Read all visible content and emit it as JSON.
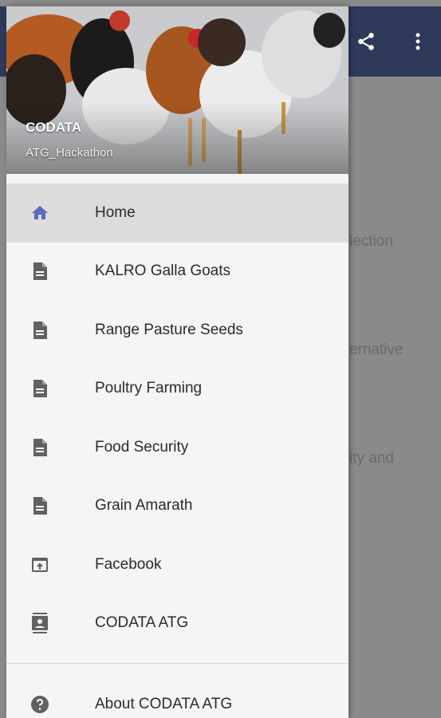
{
  "app": {
    "background_snippets": [
      "lection",
      "ernative",
      "ity and"
    ]
  },
  "drawer": {
    "header": {
      "title": "CODATA",
      "subtitle": "ATG_Hackathon"
    },
    "items": [
      {
        "label": "Home",
        "icon": "home-icon",
        "selected": true
      },
      {
        "label": "KALRO Galla Goats",
        "icon": "document-icon"
      },
      {
        "label": "Range Pasture Seeds",
        "icon": "document-icon"
      },
      {
        "label": "Poultry Farming",
        "icon": "document-icon"
      },
      {
        "label": "Food Security",
        "icon": "document-icon"
      },
      {
        "label": "Grain Amarath",
        "icon": "document-icon"
      },
      {
        "label": "Facebook",
        "icon": "open-in-browser-icon"
      },
      {
        "label": "CODATA ATG",
        "icon": "contacts-icon"
      }
    ],
    "about": {
      "label": "About CODATA ATG",
      "icon": "help-icon"
    }
  },
  "colors": {
    "toolbar": "#2f3a5b",
    "home_icon": "#5c6bc0",
    "menu_icon": "#616161"
  }
}
